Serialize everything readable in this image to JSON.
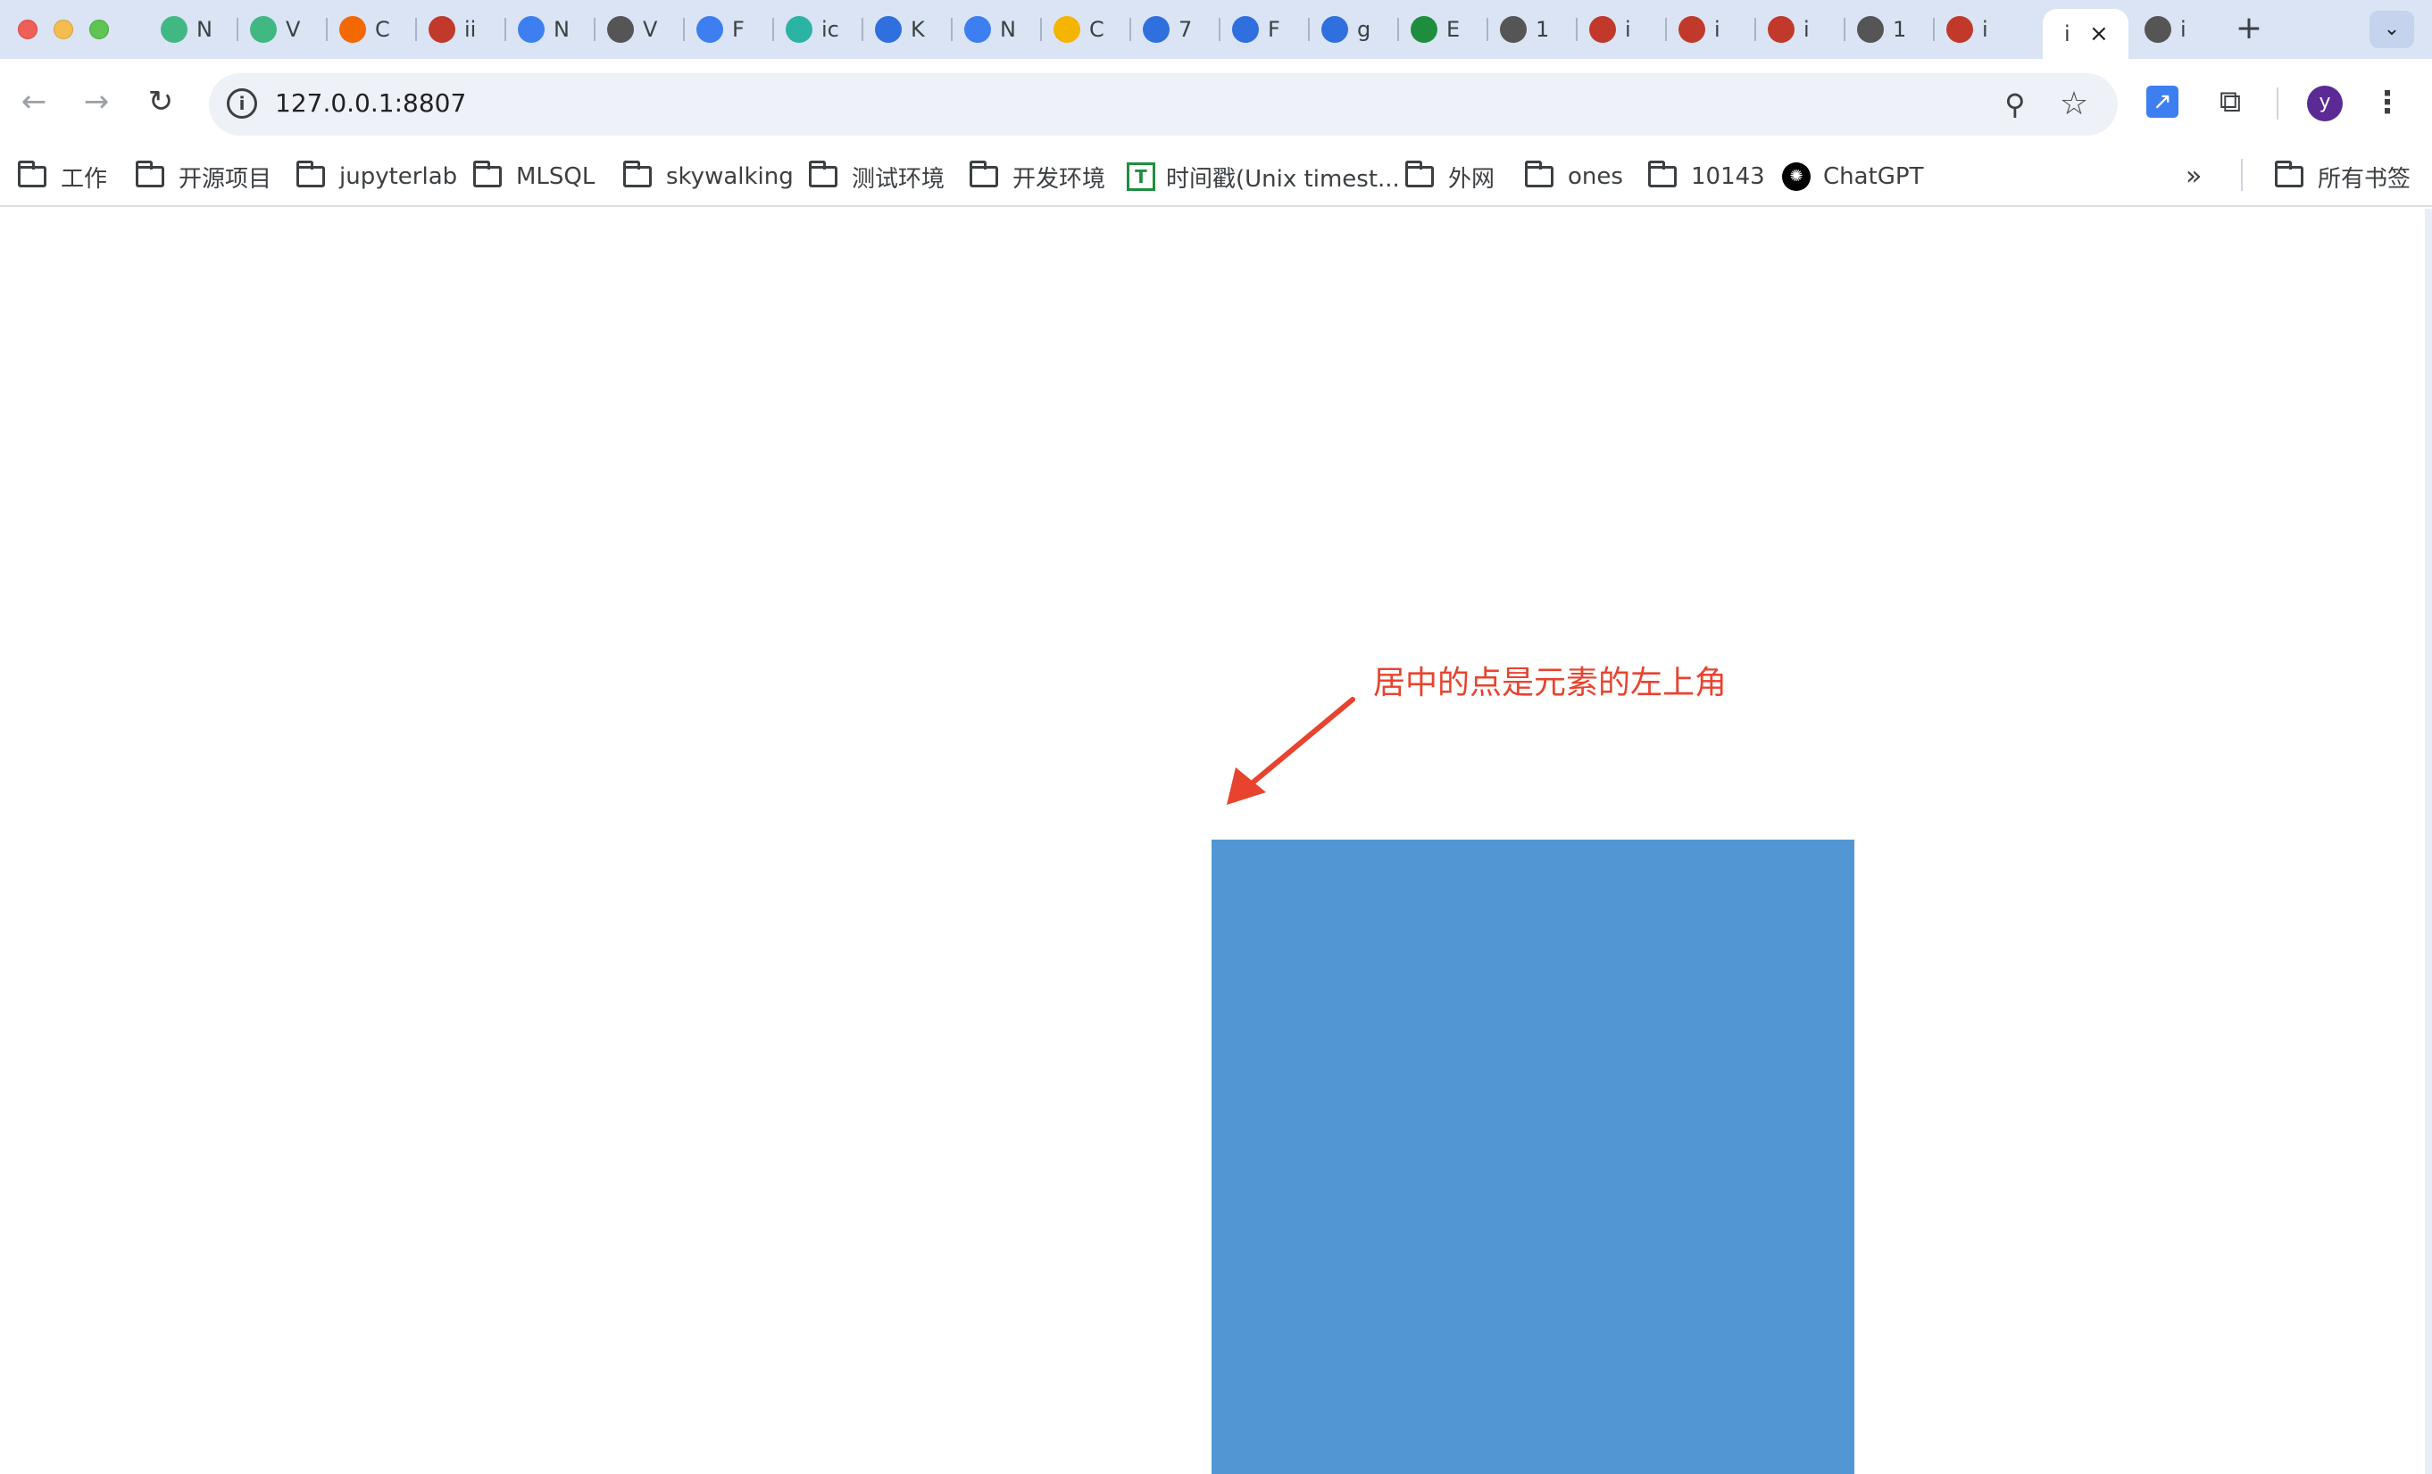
{
  "tabs": [
    {
      "label": "N",
      "icon": "vue-icon",
      "color": "#41b883"
    },
    {
      "label": "V",
      "icon": "vue-icon",
      "color": "#41b883"
    },
    {
      "label": "C",
      "icon": "grafana-icon",
      "color": "#f46800"
    },
    {
      "label": "ii",
      "icon": "app-icon",
      "color": "#c0392b"
    },
    {
      "label": "N",
      "icon": "flag-icon",
      "color": "#3d7ff1"
    },
    {
      "label": "V",
      "icon": "globe-icon",
      "color": "#555555"
    },
    {
      "label": "F",
      "icon": "flag-icon",
      "color": "#3d7ff1"
    },
    {
      "label": "ic",
      "icon": "frog-icon",
      "color": "#2bb3a3"
    },
    {
      "label": "K",
      "icon": "k-icon",
      "color": "#2f6fde"
    },
    {
      "label": "N",
      "icon": "infinity-icon",
      "color": "#3d7ff1"
    },
    {
      "label": "C",
      "icon": "bars-icon",
      "color": "#f4b400"
    },
    {
      "label": "7",
      "icon": "flame-icon",
      "color": "#2f6fde"
    },
    {
      "label": "F",
      "icon": "flame-icon",
      "color": "#2f6fde"
    },
    {
      "label": "g",
      "icon": "compass-icon",
      "color": "#2f6fde"
    },
    {
      "label": "E",
      "icon": "t-icon",
      "color": "#1e8e3e"
    },
    {
      "label": "1",
      "icon": "globe-icon",
      "color": "#555555"
    },
    {
      "label": "i",
      "icon": "app-icon",
      "color": "#c0392b"
    },
    {
      "label": "i",
      "icon": "app-icon",
      "color": "#c0392b"
    },
    {
      "label": "i",
      "icon": "app-icon",
      "color": "#c0392b"
    },
    {
      "label": "1",
      "icon": "globe-icon",
      "color": "#555555"
    },
    {
      "label": "i",
      "icon": "app-icon",
      "color": "#c0392b"
    },
    {
      "label": "i",
      "icon": "",
      "color": "",
      "active": true
    },
    {
      "label": "i",
      "icon": "globe-icon",
      "color": "#555555"
    }
  ],
  "omnibox": {
    "url": "127.0.0.1:8807"
  },
  "avatar": {
    "letter": "y"
  },
  "bookmarks": [
    {
      "label": "工作",
      "type": "folder"
    },
    {
      "label": "开源项目",
      "type": "folder"
    },
    {
      "label": "jupyterlab",
      "type": "folder"
    },
    {
      "label": "MLSQL",
      "type": "folder"
    },
    {
      "label": "skywalking",
      "type": "folder"
    },
    {
      "label": "测试环境",
      "type": "folder"
    },
    {
      "label": "开发环境",
      "type": "folder"
    },
    {
      "label": "时间戳(Unix timest...",
      "type": "link"
    },
    {
      "label": "外网",
      "type": "folder"
    },
    {
      "label": "ones",
      "type": "folder"
    },
    {
      "label": "10143",
      "type": "folder"
    },
    {
      "label": "ChatGPT",
      "type": "link"
    }
  ],
  "all_bookmarks": "所有书签",
  "page": {
    "annotation": "居中的点是元素的左上角",
    "box_color": "#5297d4",
    "annotation_color": "#e8432e"
  }
}
